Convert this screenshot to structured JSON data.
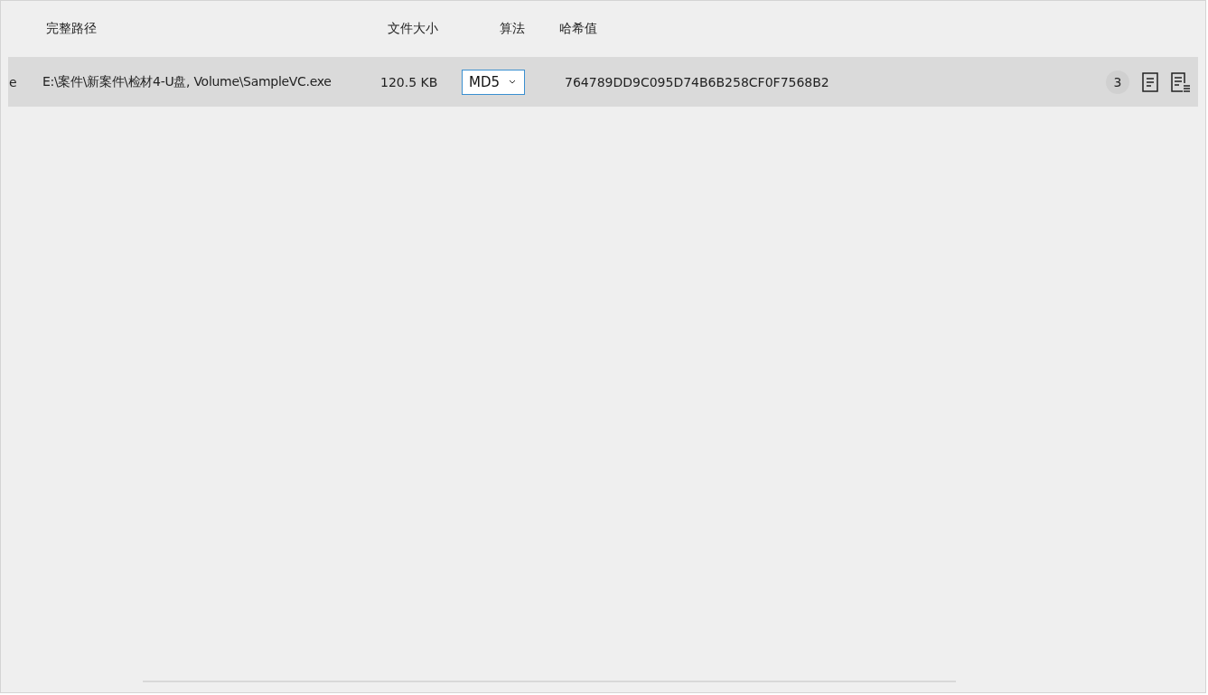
{
  "table": {
    "columns": [
      "完整路径",
      "文件大小",
      "算法",
      "哈希值"
    ],
    "rows": [
      {
        "column_1": "e",
        "path": "E:\\案件\\新案件\\检材4-U盘, Volume\\SampleVC.exe",
        "size": "120.5 KB",
        "algorithm": "MD5",
        "hash": "764789DD9C095D74B6B258CF0F7568B2",
        "count": "3",
        "selected": true
      }
    ]
  }
}
